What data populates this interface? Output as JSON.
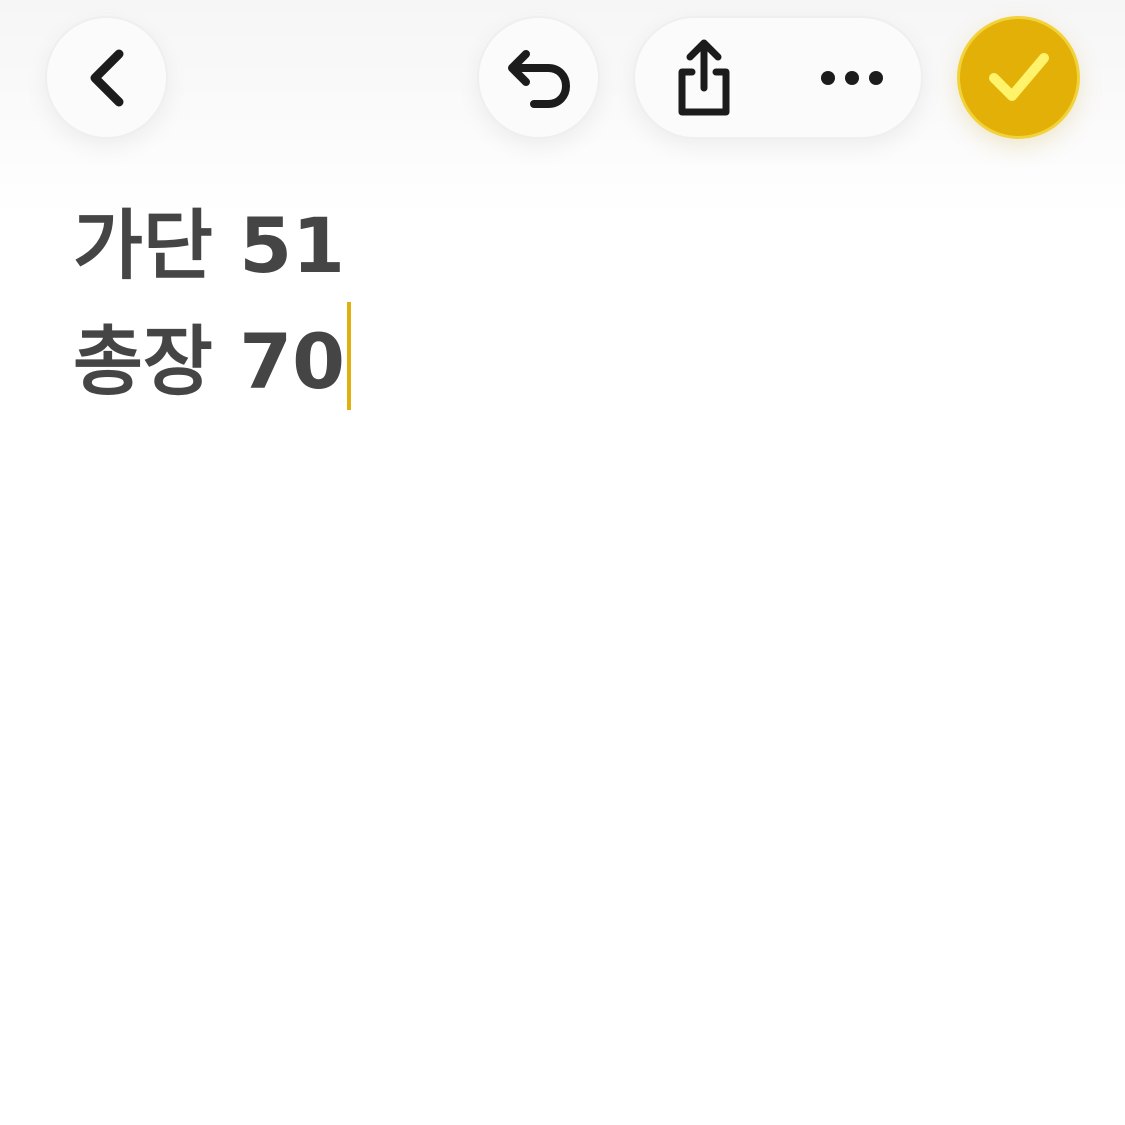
{
  "toolbar": {
    "back_icon": "chevron-left-icon",
    "undo_icon": "undo-icon",
    "share_icon": "share-icon",
    "more_icon": "ellipsis-icon",
    "done_icon": "checkmark-icon"
  },
  "colors": {
    "accent": "#e3b007",
    "check": "#fff36b",
    "text": "#454545",
    "caret": "#e0b010"
  },
  "note": {
    "lines": [
      {
        "text": "가단 51"
      },
      {
        "text": "총장 70"
      }
    ]
  }
}
